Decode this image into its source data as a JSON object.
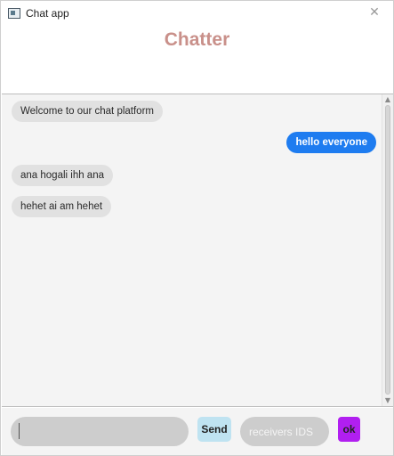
{
  "window": {
    "title": "Chat app"
  },
  "header": {
    "title": "Chatter"
  },
  "messages": [
    {
      "text": "Welcome to our chat platform",
      "direction": "incoming"
    },
    {
      "text": "hello everyone",
      "direction": "outgoing"
    },
    {
      "text": "ana hogali ihh ana",
      "direction": "incoming"
    },
    {
      "text": "hehet ai am hehet",
      "direction": "incoming"
    }
  ],
  "composer": {
    "message_value": "",
    "send_label": "Send",
    "receivers_placeholder": "receivers IDS",
    "ok_label": "ok"
  },
  "colors": {
    "header_title": "#c9908a",
    "outgoing_bubble": "#1e7cf0",
    "incoming_bubble": "#e1e1e1",
    "send_button": "#bfe3f1",
    "ok_button": "#b11ff0"
  }
}
